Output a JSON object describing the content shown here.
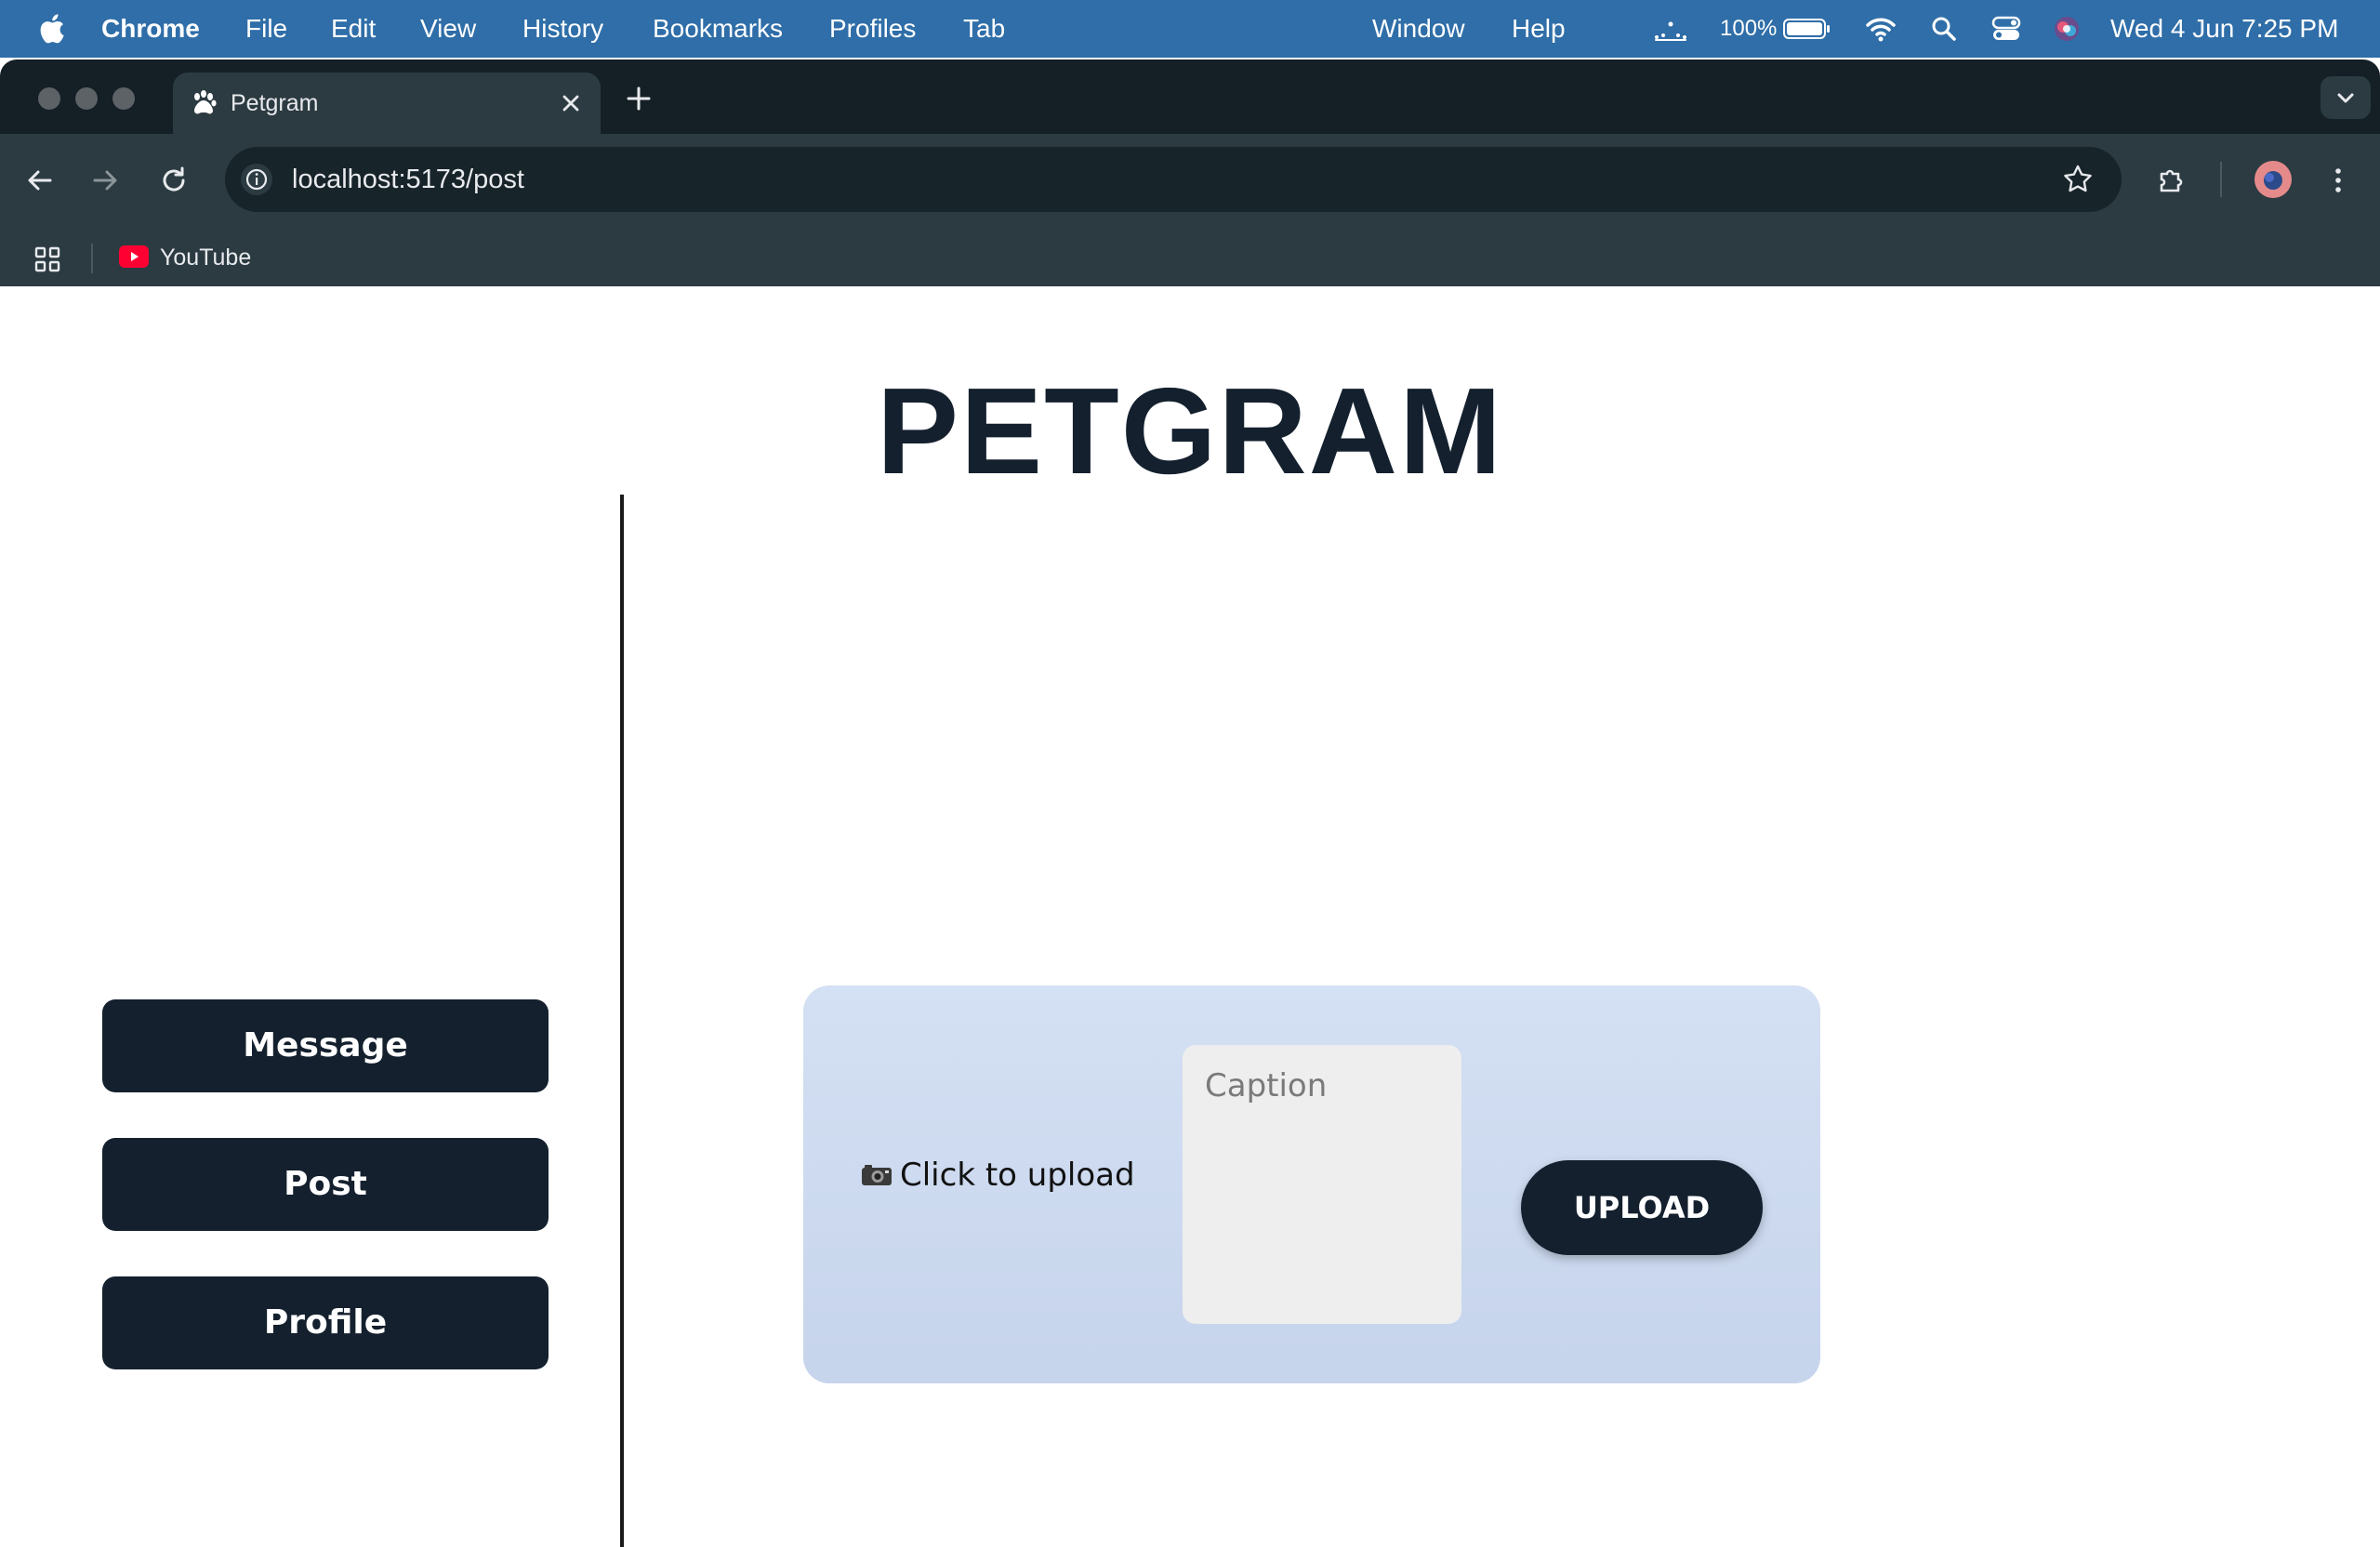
{
  "menubar": {
    "app_name": "Chrome",
    "items": [
      "File",
      "Edit",
      "View",
      "History",
      "Bookmarks",
      "Profiles",
      "Tab",
      "Window",
      "Help"
    ],
    "battery": "100%",
    "datetime": "Wed 4 Jun  7:25 PM"
  },
  "browser": {
    "tab_title": "Petgram",
    "url": "localhost:5173/post",
    "bookmarks": [
      {
        "label": "YouTube",
        "icon": "youtube-icon"
      }
    ]
  },
  "page": {
    "brand": "PETGRAM",
    "nav": {
      "message": "Message",
      "post": "Post",
      "profile": "Profile"
    },
    "upload": {
      "picker_icon": "📷",
      "picker_label": "Click to upload",
      "caption_placeholder": "Caption",
      "caption_value": "",
      "button": "UPLOAD"
    }
  },
  "colors": {
    "brand_dark": "#14202e",
    "card_bg": "#d4e0f3",
    "menubar_bg": "#2f6ea8",
    "chrome_frame": "#2c3b42"
  }
}
